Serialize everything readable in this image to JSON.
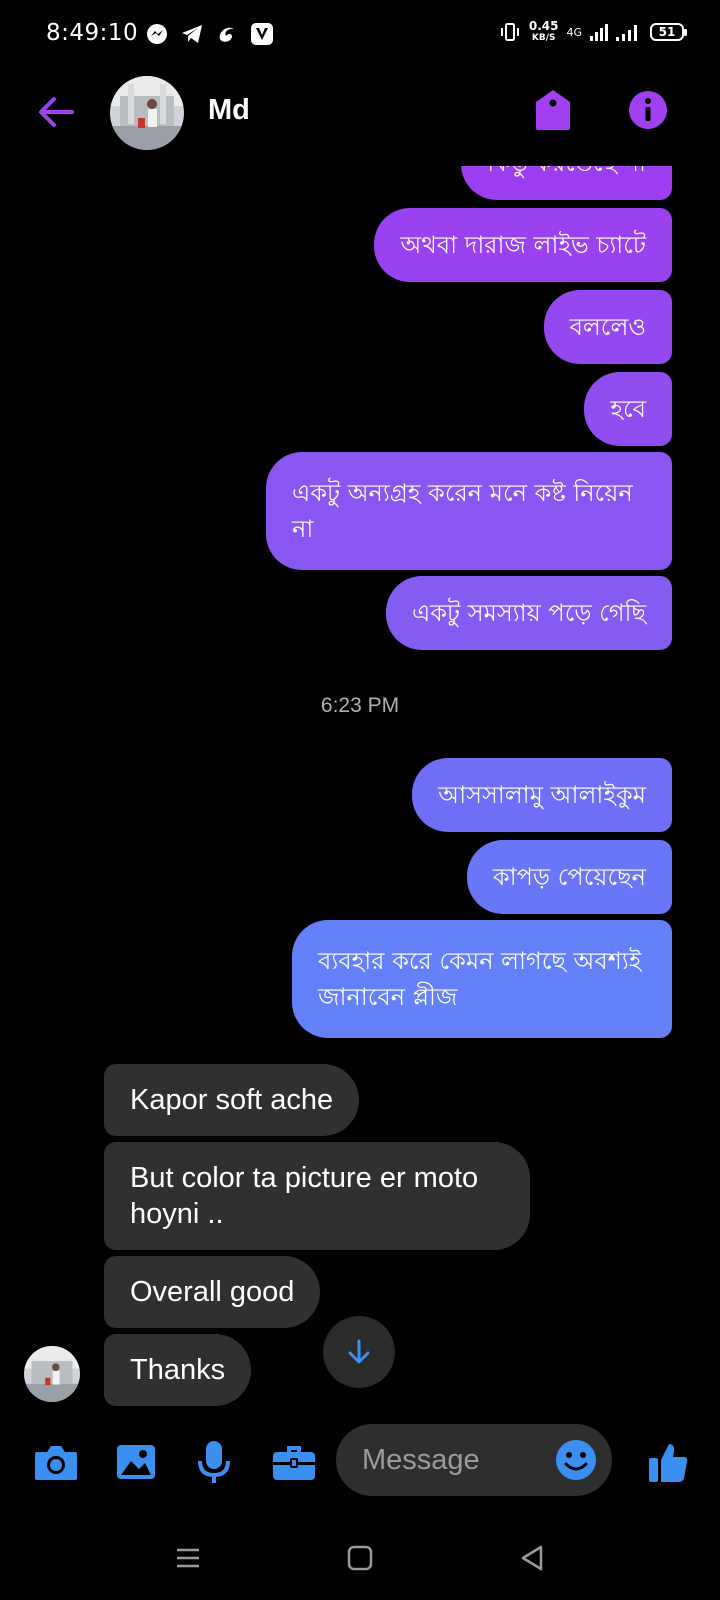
{
  "status_bar": {
    "time": "8:49:10",
    "net_speed": "0.45",
    "net_unit": "KB/S",
    "network": "4G",
    "battery": "51"
  },
  "header": {
    "contact_name": "Md",
    "accent_color": "#a040f0"
  },
  "messages_outgoing_top": [
    "কিন্তু করতেছে না",
    "অথবা দারাজ লাইভ চ্যাটে",
    "বললেও",
    "হবে",
    "একটু অন্যগ্রহ করেন মনে কষ্ট নিয়েন না",
    "একটু সমস্যায় পড়ে গেছি"
  ],
  "timestamp": "6:23 PM",
  "messages_outgoing_bottom": [
    "আসসালামু আলাইকুম",
    "কাপড় পেয়েছেন",
    "ব্যবহার করে কেমন লাগছে অবশ্যই জানাবেন প্লীজ"
  ],
  "messages_incoming": [
    "Kapor soft ache",
    "But color ta picture er moto hoyni ..",
    "Overall good",
    "Thanks"
  ],
  "composer": {
    "placeholder": "Message",
    "tools": [
      "camera-icon",
      "gallery-icon",
      "microphone-icon",
      "briefcase-icon"
    ],
    "icon_color": "#3a8ff0"
  },
  "navbar": [
    "menu-icon",
    "home-icon",
    "back-icon"
  ]
}
